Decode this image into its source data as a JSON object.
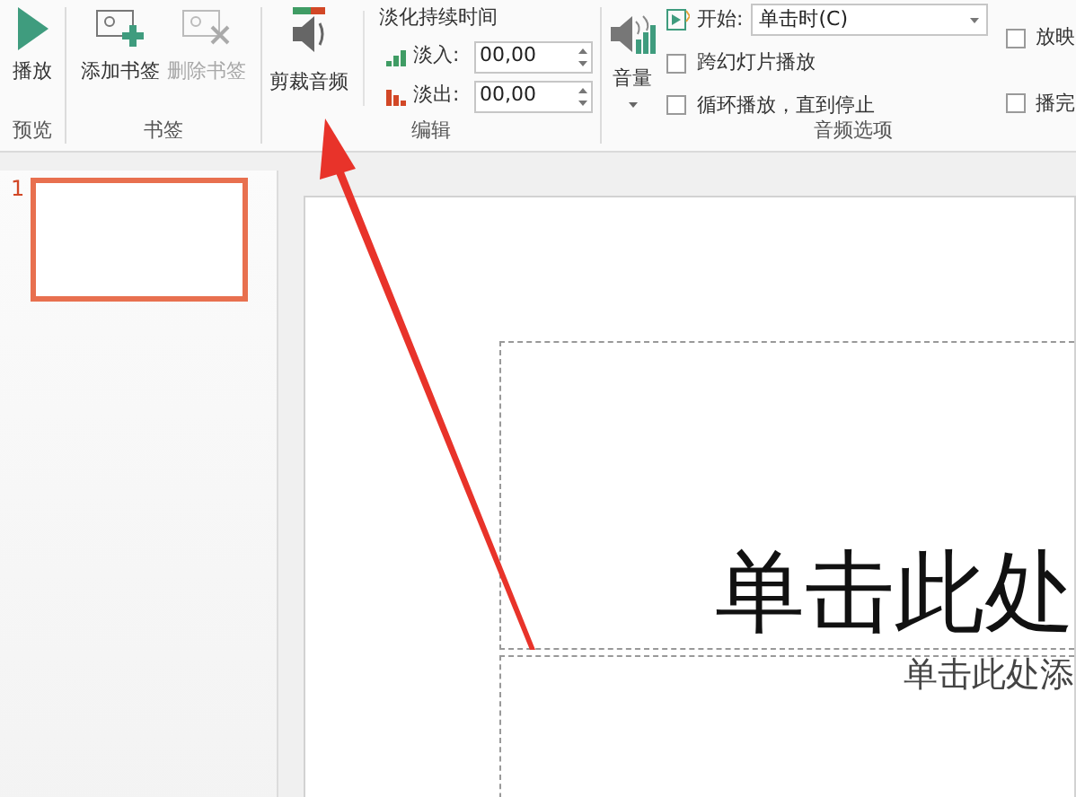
{
  "ribbon": {
    "preview": {
      "label": "预览",
      "play": {
        "label": "播放",
        "disabled": false
      }
    },
    "bookmarks": {
      "label": "书签",
      "buttons": [
        {
          "label": "添加书签",
          "disabled": false,
          "kind": "add"
        },
        {
          "label": "删除书签",
          "disabled": true,
          "kind": "remove"
        }
      ]
    },
    "editing": {
      "label": "编辑",
      "trim": {
        "label": "剪裁音频",
        "disabled": false
      },
      "fade_title": "淡化持续时间",
      "fades": [
        {
          "kind": "in",
          "label": "淡入:",
          "value": "00,00"
        },
        {
          "kind": "out",
          "label": "淡出:",
          "value": "00,00"
        }
      ]
    },
    "audio_options": {
      "label": "音频选项",
      "volume": {
        "label": "音量"
      },
      "start": {
        "label": "开始:",
        "value": "单击时(C)"
      },
      "checkboxes": [
        {
          "label": "跨幻灯片播放",
          "checked": false
        },
        {
          "label": "循环播放，直到停止",
          "checked": false
        }
      ],
      "side_checkboxes": [
        {
          "label": "放映",
          "checked": false
        },
        {
          "label": "播完",
          "checked": false
        }
      ]
    }
  },
  "thumbnails": [
    {
      "number": "1",
      "selected": true
    }
  ],
  "slide": {
    "title": "单击此处",
    "subtitle": "单击此处添"
  }
}
